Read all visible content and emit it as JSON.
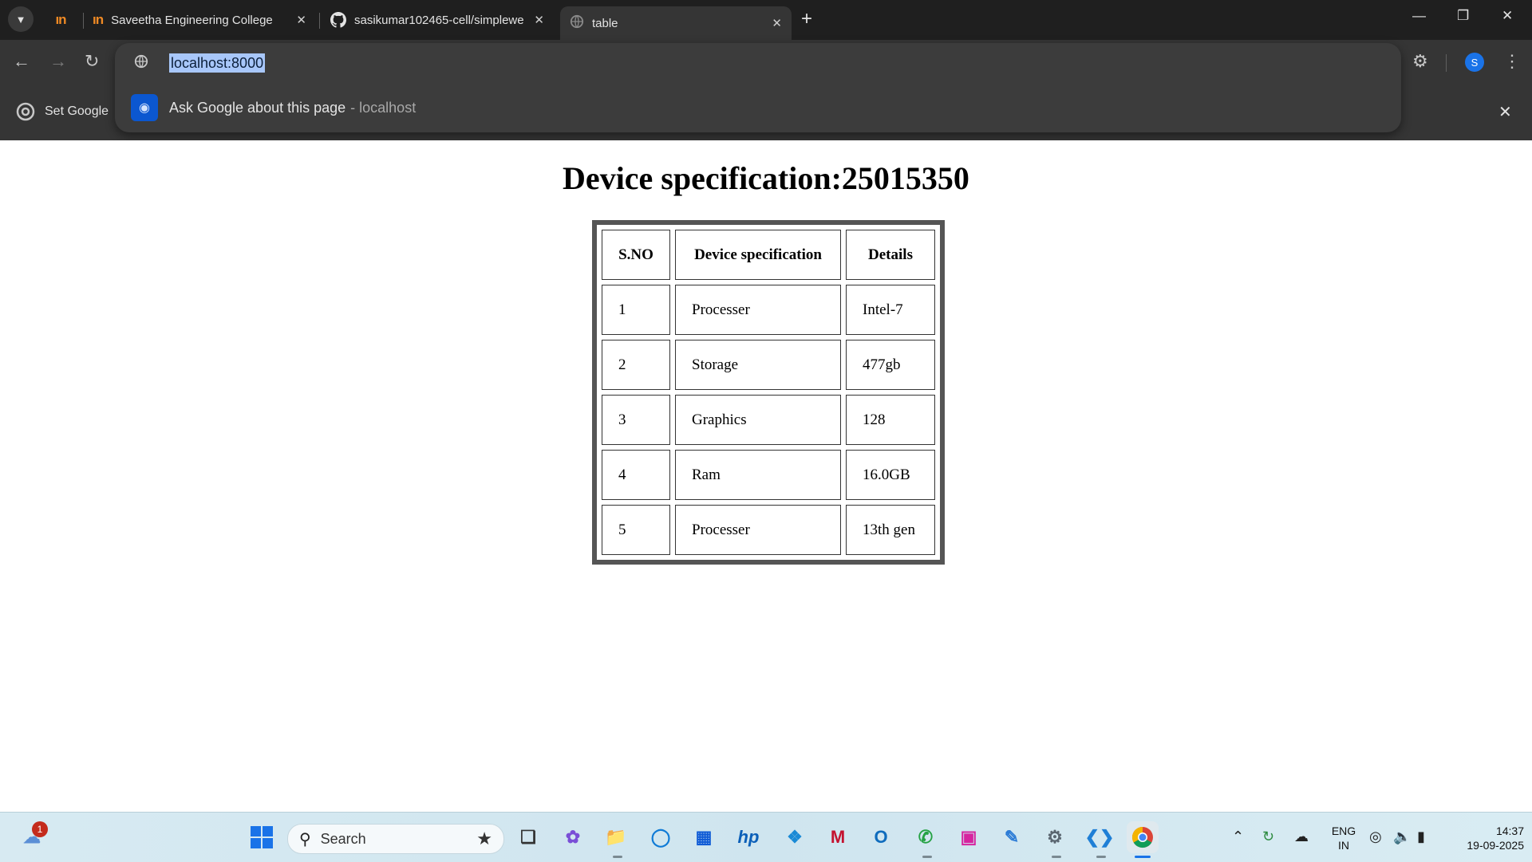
{
  "browser": {
    "tabs": [
      {
        "title": "",
        "icon": "mn-logo-icon",
        "pinned": true
      },
      {
        "title": "Saveetha Engineering College",
        "icon": "mn-logo-icon"
      },
      {
        "title": "sasikumar102465-cell/simplewe",
        "icon": "github-icon"
      },
      {
        "title": "table",
        "icon": "globe-icon",
        "active": true
      }
    ],
    "close_glyph": "✕",
    "new_tab_glyph": "+",
    "omnibox": {
      "value": "localhost:8000",
      "suggestion_text": "Ask Google about this page",
      "suggestion_domain": "- localhost"
    },
    "bookmark_bar": {
      "item_label": "Set Google"
    },
    "profile_initial": "S"
  },
  "page": {
    "heading": "Device specification:25015350",
    "table": {
      "headers": [
        "S.NO",
        "Device specification",
        "Details"
      ],
      "rows": [
        [
          "1",
          "Processer",
          "Intel-7"
        ],
        [
          "2",
          "Storage",
          "477gb"
        ],
        [
          "3",
          "Graphics",
          "128"
        ],
        [
          "4",
          "Ram",
          "16.0GB"
        ],
        [
          "5",
          "Processer",
          "13th gen"
        ]
      ]
    }
  },
  "taskbar": {
    "weather_badge": "1",
    "search_label": "Search",
    "language": {
      "line1": "ENG",
      "line2": "IN"
    },
    "clock": {
      "time": "14:37",
      "date": "19-09-2025"
    }
  }
}
